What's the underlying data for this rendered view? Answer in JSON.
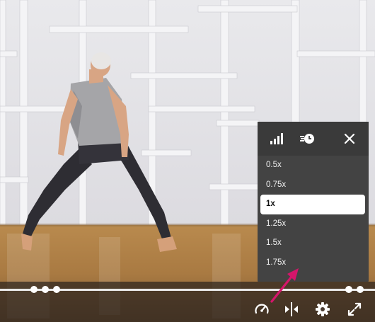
{
  "video": {
    "scene": "dancer-in-studio"
  },
  "speed_panel": {
    "header_icons": [
      "signal-bars-icon",
      "speed-clock-icon",
      "close-icon"
    ],
    "options": [
      {
        "label": "0.5x",
        "selected": false
      },
      {
        "label": "0.75x",
        "selected": false
      },
      {
        "label": "1x",
        "selected": true
      },
      {
        "label": "1.25x",
        "selected": false
      },
      {
        "label": "1.5x",
        "selected": false
      },
      {
        "label": "1.75x",
        "selected": false
      }
    ]
  },
  "controls": {
    "icons": [
      "speedometer-icon",
      "mirror-icon",
      "gear-icon",
      "fullscreen-icon"
    ]
  },
  "colors": {
    "accent_arrow": "#d6156b",
    "panel_bg": "#434343",
    "selected_bg": "#ffffff"
  }
}
